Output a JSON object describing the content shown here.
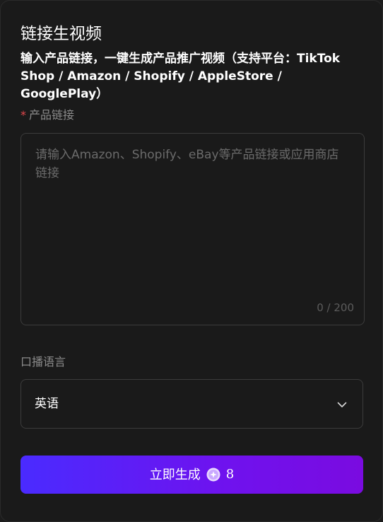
{
  "header": {
    "title": "链接生视频",
    "subtitle": "输入产品链接，一键生成产品推广视频（支持平台：TikTok Shop / Amazon / Shopify / AppleStore / GooglePlay）"
  },
  "product_link": {
    "required_mark": "*",
    "label": "产品链接",
    "value": "",
    "placeholder": "请输入Amazon、Shopify、eBay等产品链接或应用商店链接",
    "char_count": "0 / 200"
  },
  "voice_language": {
    "label": "口播语言",
    "selected": "英语",
    "icon": "chevron-down-icon"
  },
  "generate": {
    "label": "立即生成",
    "cost": "8",
    "icon": "coin-icon",
    "gradient_start": "#4a2bff",
    "gradient_end": "#7a0be0"
  },
  "colors": {
    "background": "#1a1a1a",
    "border": "#3c3c3c",
    "required": "#e5484d"
  }
}
